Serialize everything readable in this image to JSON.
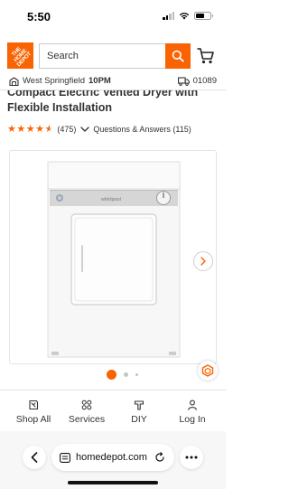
{
  "status_bar": {
    "time": "5:50"
  },
  "header": {
    "logo_text": "THE HOME DEPOT",
    "search_placeholder": "Search",
    "brand_color": "#f96302"
  },
  "store_bar": {
    "store_name": "West Springfield",
    "store_hours": "10PM",
    "zip_code": "01089"
  },
  "product": {
    "title": "Compact Electric Vented Dryer with Flexible Installation",
    "rating": 4.5,
    "review_count": "(475)",
    "qa_label": "Questions & Answers (115)",
    "image_brand": "whirlpool"
  },
  "carousel": {
    "active_index": 0,
    "total_visible_dots": 3
  },
  "bottom_nav": {
    "items": [
      {
        "label": "Shop All",
        "icon": "shop-all-icon"
      },
      {
        "label": "Services",
        "icon": "services-icon"
      },
      {
        "label": "DIY",
        "icon": "diy-icon"
      },
      {
        "label": "Log In",
        "icon": "user-icon"
      }
    ]
  },
  "safari": {
    "url": "homedepot.com"
  }
}
